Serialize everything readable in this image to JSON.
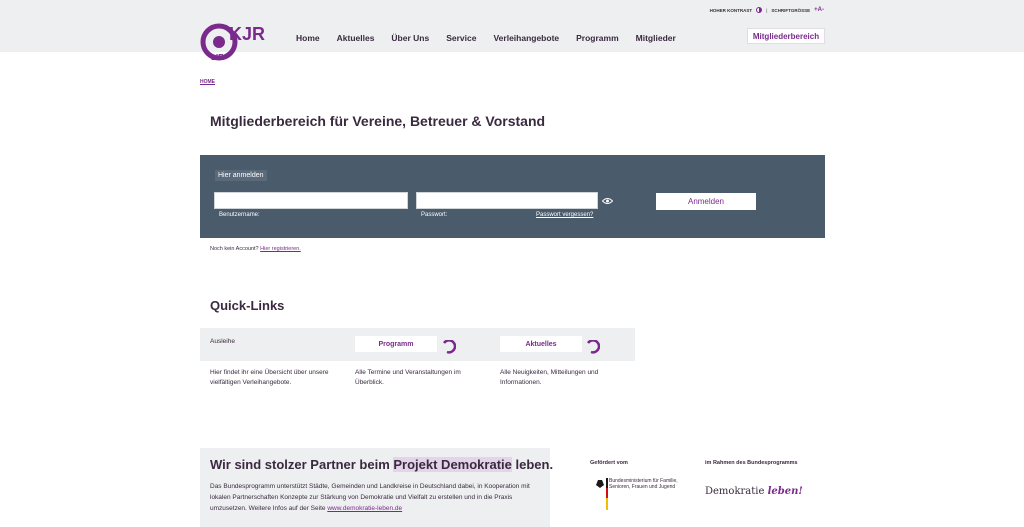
{
  "header": {
    "nav": [
      "Home",
      "Aktuelles",
      "Über Uns",
      "Service",
      "Verleihangebote",
      "Programm",
      "Mitglieder"
    ],
    "contrast_label": "Hoher Kontrast",
    "font_label": "Schriftgröße",
    "font_controls": "+A-",
    "member_button": "Mitgliederbereich",
    "logo_text": "KJR"
  },
  "breadcrumb": "HOME",
  "page_title": "Mitgliederbereich für Vereine, Betreuer & Vorstand",
  "login": {
    "heading": "Hier anmelden",
    "username_label": "Benutzername:",
    "password_label": "Passwort:",
    "forgot_link": "Passwort vergessen?",
    "submit": "Anmelden",
    "username_value": "",
    "password_value": ""
  },
  "register": {
    "text": "Noch kein Account?",
    "link": "Hier registrieren."
  },
  "quicklinks": {
    "title": "Quick-Links",
    "label": "Ausleihe",
    "buttons": [
      "Programm",
      "Aktuelles"
    ],
    "descriptions": [
      "Hier findet ihr eine Übersicht über unsere vielfältigen Verleihangebote.",
      "Alle Termine und Veranstaltungen im Überblick.",
      "Alle Neuigkeiten, Mitteilungen und Informationen."
    ]
  },
  "partner": {
    "title_pre": "Wir sind stolzer Partner beim ",
    "title_highlight": "Projekt Demokratie",
    "title_post": " leben.",
    "text": "Das Bundesprogramm unterstützt Städte, Gemeinden und Landkreise in Deutschland dabei, in Kooperation mit lokalen Partnerschaften Konzepte zur Stärkung von Demokratie und Vielfalt zu erstellen und in die Praxis umzusetzen. Weitere Infos auf der Seite ",
    "link": "www.demokratie-leben.de",
    "gefoerdert": "Gefördert vom",
    "rahmen": "im Rahmen des Bundesprogramms",
    "ministry": "Bundesministerium für Familie, Senioren, Frauen und Jugend",
    "demo_word": "Demokratie",
    "demo_leben": "leben!"
  },
  "colors": {
    "accent": "#7a2a8c",
    "panel": "#4a5b6b",
    "bar": "#eeeff1",
    "text": "#3a2a3f"
  }
}
